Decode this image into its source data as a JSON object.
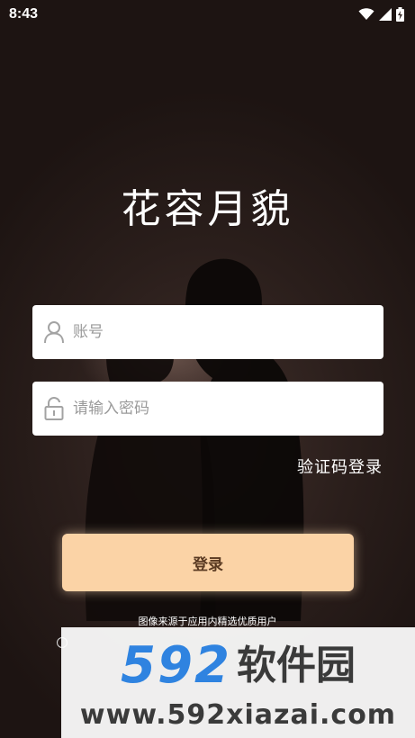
{
  "status_bar": {
    "time": "8:43",
    "icons": [
      "wifi-icon",
      "cell-signal-icon",
      "battery-icon"
    ]
  },
  "app": {
    "logo_text": "花容月貌"
  },
  "form": {
    "account_placeholder": "账号",
    "account_value": "",
    "password_placeholder": "请输入密码",
    "password_value": "",
    "sms_login_label": "验证码登录",
    "login_label": "登录"
  },
  "footer": {
    "disclaimer": "图像来源于应用内精选优质用户"
  },
  "watermark": {
    "number": "592",
    "name": "软件园",
    "url": "www.592xiazai.com"
  },
  "colors": {
    "background": "#2a1d1a",
    "login_button": "#fbd3a6",
    "login_text": "#5a3a22",
    "watermark_blue": "#2f83e0"
  }
}
